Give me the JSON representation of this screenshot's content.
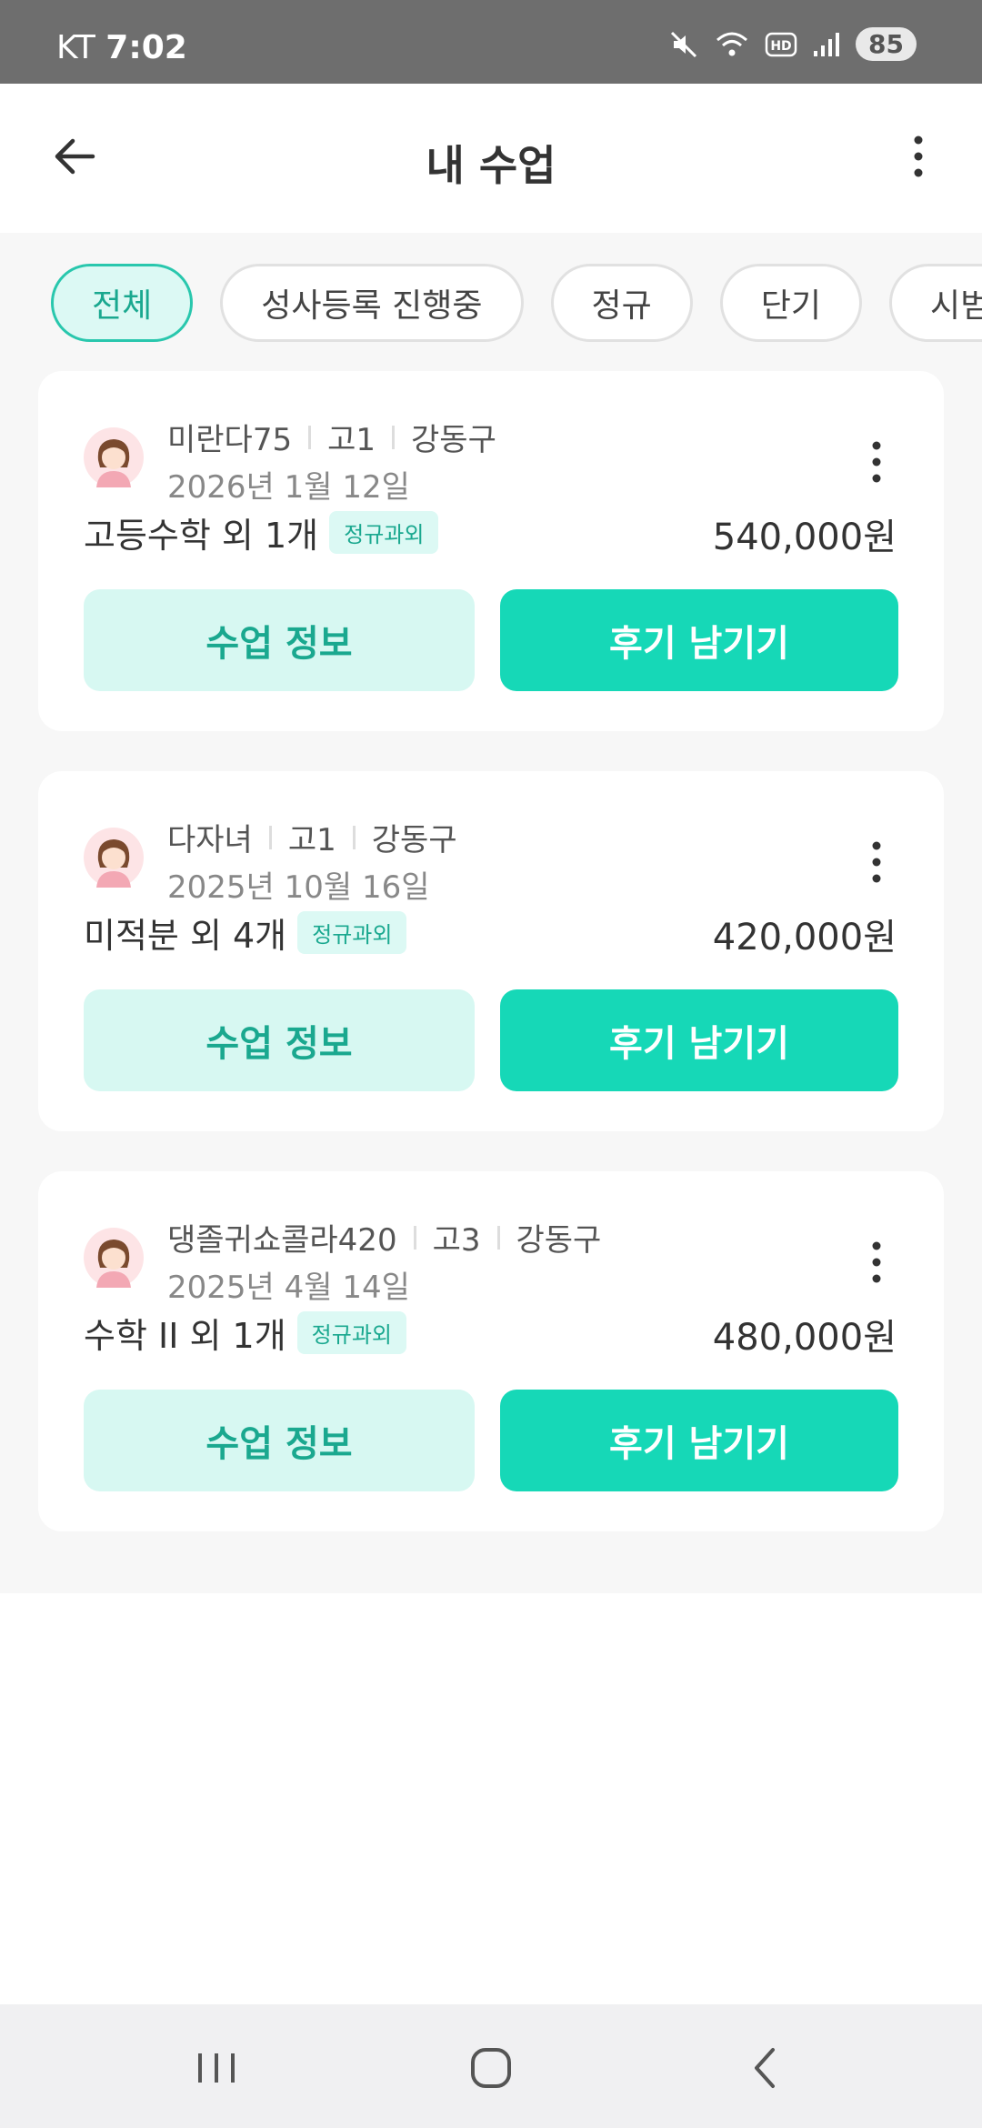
{
  "status": {
    "carrier": "KT",
    "time": "7:02",
    "battery": "85",
    "icons": [
      "mute-icon",
      "wifi-icon",
      "hd-icon",
      "signal-icon"
    ]
  },
  "app_bar": {
    "title": "내 수업",
    "back_icon": "arrow-left-icon",
    "menu_icon": "more-vertical-icon"
  },
  "filters": [
    "전체",
    "성사등록 진행중",
    "정규",
    "단기",
    "시범"
  ],
  "colors": {
    "accent": "#16d8b7",
    "accent_light": "#d7f8f2",
    "accent_text": "#1aa88f"
  },
  "lessons": [
    {
      "name": "미란다75",
      "grade": "고1",
      "region": "강동구",
      "date": "2026년 1월 12일",
      "subject": "고등수학 외 1개",
      "tag": "정규과외",
      "price": "540,000원",
      "info_label": "수업 정보",
      "review_label": "후기 남기기"
    },
    {
      "name": "다자녀",
      "grade": "고1",
      "region": "강동구",
      "date": "2025년 10월 16일",
      "subject": "미적분 외 4개",
      "tag": "정규과외",
      "price": "420,000원",
      "info_label": "수업 정보",
      "review_label": "후기 남기기"
    },
    {
      "name": "댕졸귀쇼콜라420",
      "grade": "고3",
      "region": "강동구",
      "date": "2025년 4월 14일",
      "subject": "수학 II 외 1개",
      "tag": "정규과외",
      "price": "480,000원",
      "info_label": "수업 정보",
      "review_label": "후기 남기기"
    }
  ]
}
